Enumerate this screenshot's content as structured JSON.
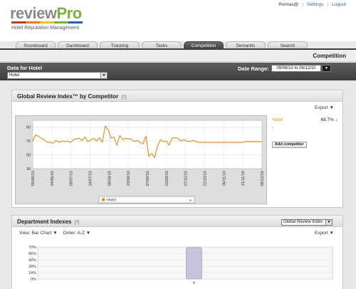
{
  "header": {
    "logo_part1": "review",
    "logo_part2": "Pro",
    "tagline": "Hotel Reputation Management",
    "user": "thomas@",
    "settings_link": "Settings",
    "logout_link": "Logout",
    "logo_bar_colors": [
      "#c0392b",
      "#e67e22",
      "#f1c40f",
      "#7ab13a",
      "#2a63b0"
    ]
  },
  "tabs": [
    {
      "label": "Scoreboard",
      "active": false
    },
    {
      "label": "Dashboard",
      "active": false
    },
    {
      "label": "Tracking",
      "active": false
    },
    {
      "label": "Tasks",
      "active": false
    },
    {
      "label": "Competition",
      "active": true
    },
    {
      "label": "Semantic",
      "active": false
    },
    {
      "label": "Search",
      "active": false
    }
  ],
  "page": {
    "title": "Competition"
  },
  "filter": {
    "label": "Data for Hotel",
    "hotel_selected": "Hotel",
    "date_range_label": "Date Range:",
    "date_range_value": "09/06/10 to 06/12/10"
  },
  "panel_gri": {
    "title": "Global Review Index™ by Competitor",
    "help": "[?]",
    "export": "Export ▼",
    "legend": {
      "name": "Hotel",
      "value": "68.7% ↓",
      "dash": "-"
    },
    "add_competitor": "Add competitor"
  },
  "chart_data": {
    "type": "line",
    "xlabel": "",
    "ylabel": "",
    "ylim": [
      30,
      100
    ],
    "yticks": [
      30,
      50,
      70,
      90
    ],
    "x_ticks": [
      "09/06/10",
      "24/06/10",
      "09/07/10",
      "24/07/10",
      "08/08/10",
      "23/08/10",
      "07/09/10",
      "22/09/10",
      "07/10/10",
      "22/10/10",
      "06/11/10",
      "21/11/10",
      "06/12/10"
    ],
    "legend_entries": [
      "Hotel"
    ],
    "grid": true,
    "series": [
      {
        "name": "Hotel",
        "color": "#e08a18",
        "values": [
          70,
          79,
          77,
          74,
          72,
          68,
          68,
          67,
          71,
          68,
          70,
          69,
          70,
          68,
          72,
          73,
          74,
          71,
          76,
          69,
          72,
          74,
          70,
          75,
          68,
          92,
          86,
          74,
          76,
          64,
          78,
          72,
          74,
          73,
          73,
          69,
          71,
          68,
          66,
          77,
          48,
          52,
          46,
          63,
          72,
          69,
          70,
          64,
          74,
          75,
          74,
          70,
          72,
          70,
          69,
          71,
          70,
          68,
          68,
          68,
          68,
          68,
          68,
          68,
          68,
          68,
          68,
          68,
          68,
          68,
          68,
          68,
          68,
          69,
          69,
          69,
          69,
          69,
          69,
          69
        ]
      }
    ]
  },
  "panel_dept": {
    "title": "Department Indexes",
    "help": "[?]",
    "select_value": "Global Review Index",
    "view_label": "View: Bar Chart ▼",
    "order_label": "Order: A-Z ▼",
    "export": "Export ▼"
  },
  "dept_chart": {
    "type": "bar",
    "yticks": [
      "70%",
      "56%",
      "42%",
      "28%",
      "14%",
      "0%"
    ],
    "ylim": [
      0,
      70
    ],
    "categories": [
      "ô"
    ],
    "values": [
      68.7
    ],
    "bar_color": "#c9c2dc"
  }
}
